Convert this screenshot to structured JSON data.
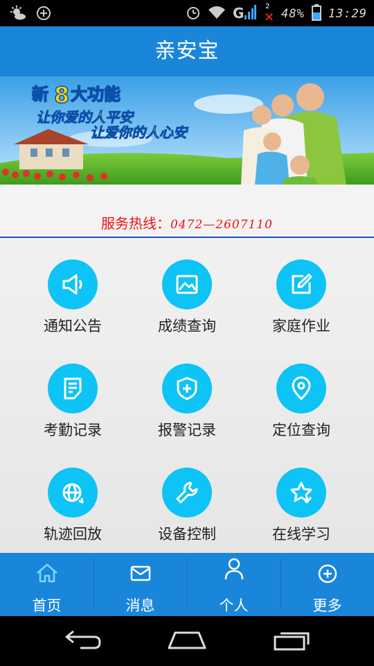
{
  "status_bar": {
    "battery": "48%",
    "time": "13:29",
    "sim_badge": "2"
  },
  "header": {
    "title": "亲安宝"
  },
  "banner": {
    "headline_prefix": "新",
    "headline_number": "8",
    "headline_suffix": "大功能",
    "line1": "让你爱的人平安",
    "line2": "让爱你的人心安"
  },
  "hotline": {
    "label": "服务热线：",
    "number": "0472—2607110"
  },
  "features": [
    {
      "label": "通知公告",
      "icon": "megaphone-icon"
    },
    {
      "label": "成绩查询",
      "icon": "image-icon"
    },
    {
      "label": "家庭作业",
      "icon": "edit-icon"
    },
    {
      "label": "考勤记录",
      "icon": "document-icon"
    },
    {
      "label": "报警记录",
      "icon": "shield-plus-icon"
    },
    {
      "label": "定位查询",
      "icon": "location-pin-icon"
    },
    {
      "label": "轨迹回放",
      "icon": "globe-refresh-icon"
    },
    {
      "label": "设备控制",
      "icon": "wrench-icon"
    },
    {
      "label": "在线学习",
      "icon": "star-check-icon"
    }
  ],
  "bottom_nav": [
    {
      "label": "首页",
      "icon": "home-icon",
      "active": true
    },
    {
      "label": "消息",
      "icon": "mail-icon"
    },
    {
      "label": "个人",
      "icon": "person-icon"
    },
    {
      "label": "更多",
      "icon": "plus-circle-icon"
    }
  ],
  "colors": {
    "primary": "#1a86d9",
    "tile_circle": "#0ec3f5",
    "hotline": "#e11111",
    "active_nav_icon": "#7fd6ff"
  }
}
